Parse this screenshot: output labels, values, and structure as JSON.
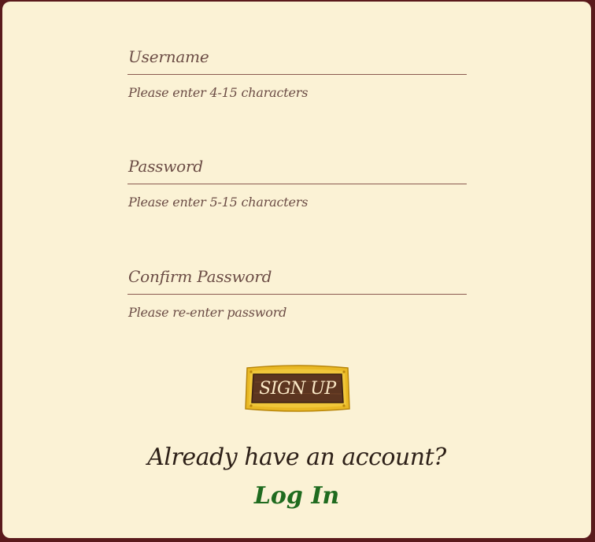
{
  "form": {
    "fields": [
      {
        "label": "Username",
        "hint": "Please enter 4-15 characters"
      },
      {
        "label": "Password",
        "hint": "Please enter 5-15 characters"
      },
      {
        "label": "Confirm Password",
        "hint": "Please re-enter password"
      }
    ],
    "signup_label": "SIGN UP"
  },
  "footer": {
    "question": "Already have an account?",
    "login_label": "Log In"
  },
  "colors": {
    "frame": "#5a1a1c",
    "panel": "#fbf2d5",
    "text": "#6b4c45",
    "link": "#1f6b1f",
    "button_wood": "#5c3520",
    "button_gold": "#e9b824"
  }
}
